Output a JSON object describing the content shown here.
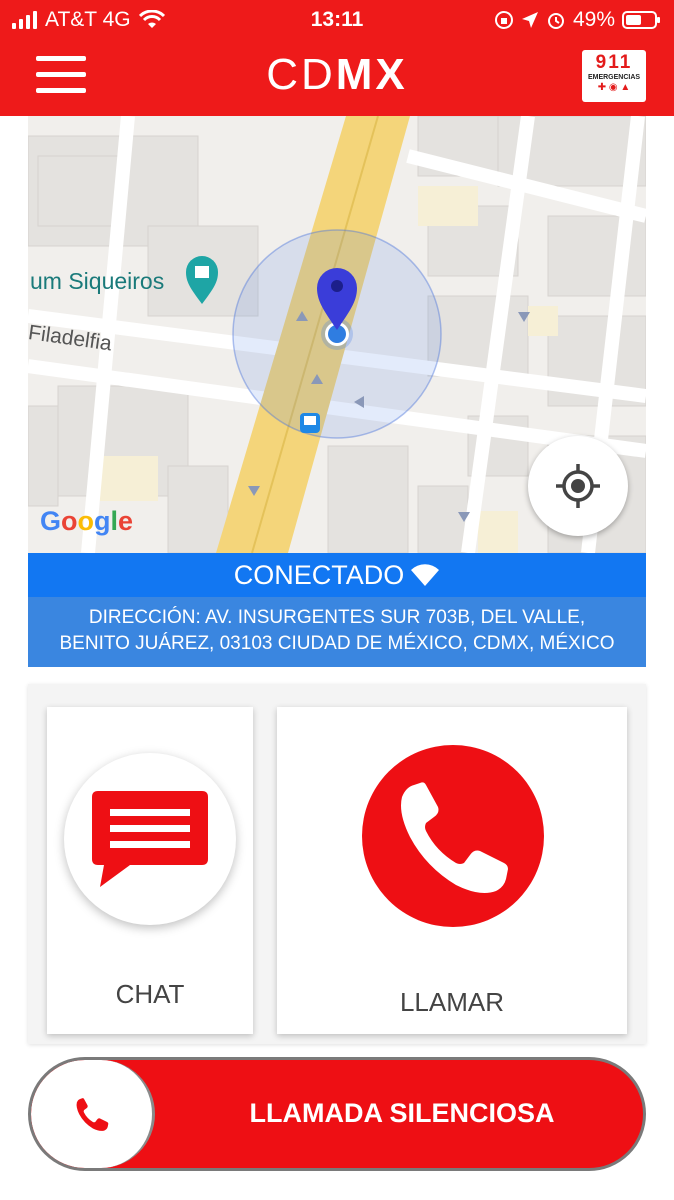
{
  "status_bar": {
    "carrier": "AT&T 4G",
    "time": "13:11",
    "battery": "49%"
  },
  "app_bar": {
    "title_light": "CD",
    "title_bold": "MX",
    "badge_number": "911",
    "badge_label": "EMERGENCIAS"
  },
  "map": {
    "place_label": "um Siqueiros",
    "street_label": "Filadelfia",
    "attribution": "Google"
  },
  "connection": {
    "status": "CONECTADO",
    "address_line1": "DIRECCIÓN: AV. INSURGENTES SUR 703B, DEL VALLE,",
    "address_line2": "BENITO JUÁREZ, 03103 CIUDAD DE MÉXICO, CDMX, MÉXICO"
  },
  "actions": {
    "chat_label": "CHAT",
    "call_label": "LLAMAR"
  },
  "silent_call": {
    "label": "LLAMADA SILENCIOSA"
  },
  "colors": {
    "brand_red": "#ee1a1a",
    "connected_blue": "#1277f2"
  }
}
